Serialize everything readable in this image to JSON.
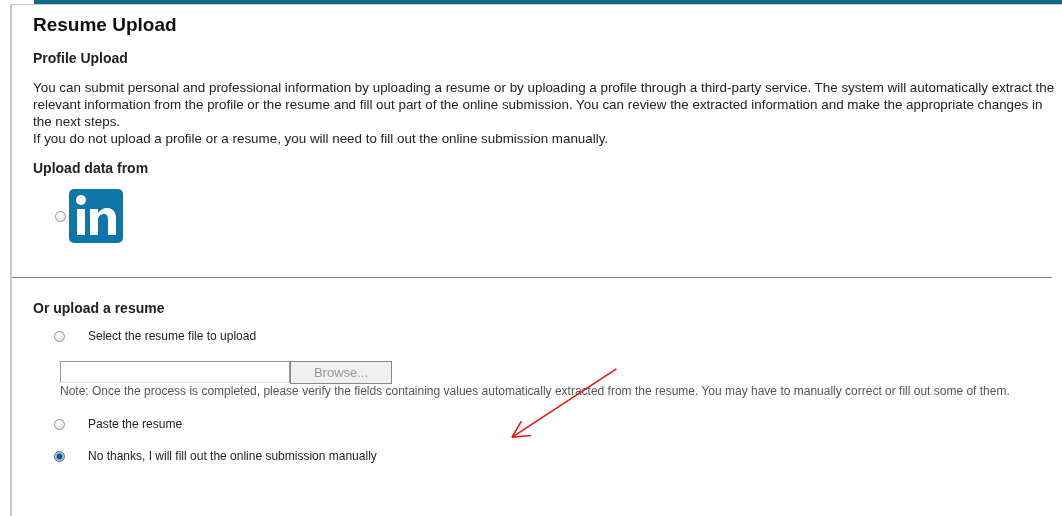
{
  "page": {
    "title": "Resume Upload"
  },
  "profile_upload": {
    "heading": "Profile Upload",
    "paragraphs": [
      "You can submit personal and professional information by uploading a resume or by uploading a profile through a third-party service. The system will automatically extract the relevant information from the profile or the resume and fill out part of the online submission. You can review the extracted information and make the appropriate changes in the next steps.",
      "If you do not upload a profile or a resume, you will need to fill out the online submission manually."
    ]
  },
  "upload_data_from": {
    "heading": "Upload data from",
    "selected": false
  },
  "resume_options": {
    "heading": "Or upload a resume",
    "options": [
      {
        "kind": "file",
        "label": "Select the resume file to upload",
        "selected": false,
        "browse_button": "Browse...",
        "note": "Note: Once the process is completed, please verify the fields containing values automatically extracted from the resume. You may have to manually correct or fill out some of them."
      },
      {
        "kind": "plain",
        "label": "Paste the resume",
        "selected": false
      },
      {
        "kind": "plain",
        "label": "No thanks, I will fill out the online submission manually",
        "selected": true
      }
    ]
  },
  "annotation": {
    "kind": "arrow"
  }
}
